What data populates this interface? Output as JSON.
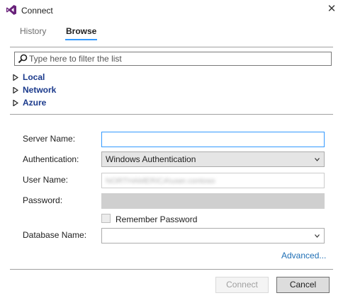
{
  "window": {
    "title": "Connect",
    "close_icon": "close-icon",
    "app_icon": "visual-studio-icon"
  },
  "tabs": [
    {
      "label": "History",
      "active": false
    },
    {
      "label": "Browse",
      "active": true
    }
  ],
  "filter": {
    "placeholder": "Type here to filter the list",
    "value": "",
    "icon": "search-icon"
  },
  "tree": [
    {
      "label": "Local",
      "expanded": false
    },
    {
      "label": "Network",
      "expanded": false
    },
    {
      "label": "Azure",
      "expanded": false
    }
  ],
  "form": {
    "server_name_label": "Server Name:",
    "server_name_value": "",
    "authentication_label": "Authentication:",
    "authentication_value": "Windows Authentication",
    "user_name_label": "User Name:",
    "user_name_value": "NORTHAMERICA\\user.contoso",
    "password_label": "Password:",
    "password_value": "",
    "remember_password_label": "Remember Password",
    "remember_password_checked": false,
    "database_name_label": "Database Name:",
    "database_name_value": "",
    "advanced_link": "Advanced..."
  },
  "buttons": {
    "connect_label": "Connect",
    "cancel_label": "Cancel"
  },
  "colors": {
    "accent": "#3399ff",
    "tree_text": "#1b3a8c",
    "link": "#1f6fb5",
    "vs_purple": "#68217a"
  }
}
